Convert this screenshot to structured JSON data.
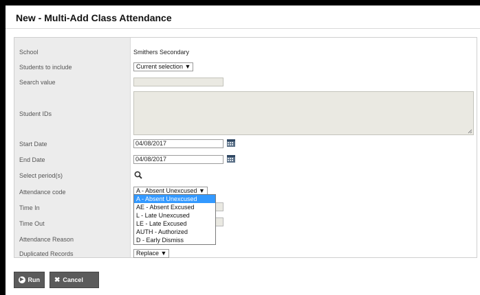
{
  "dialog": {
    "title": "New - Multi-Add Class Attendance"
  },
  "form": {
    "labels": {
      "school": "School",
      "students_to_include": "Students to include",
      "search_value": "Search value",
      "student_ids": "Student IDs",
      "start_date": "Start Date",
      "end_date": "End Date",
      "select_periods": "Select period(s)",
      "attendance_code": "Attendance code",
      "time_in": "Time In",
      "time_out": "Time Out",
      "attendance_reason": "Attendance Reason",
      "duplicated_records": "Duplicated Records"
    },
    "school_value": "Smithers Secondary",
    "students_to_include_value": "Current selection ▼",
    "start_date_value": "04/08/2017",
    "end_date_value": "04/08/2017",
    "attendance_code_value": "A - Absent Unexcused ▼",
    "attendance_code_options": [
      "A - Absent Unexcused",
      "AE - Absent Excused",
      "L - Late Unexcused",
      "LE - Late Excused",
      "AUTH - Authorized",
      "D - Early Dismiss"
    ],
    "duplicated_records_value": "Replace ▼"
  },
  "buttons": {
    "run": "Run",
    "cancel": "Cancel"
  },
  "colors": {
    "highlight": "#3399ff",
    "button": "#5b5b5b"
  }
}
